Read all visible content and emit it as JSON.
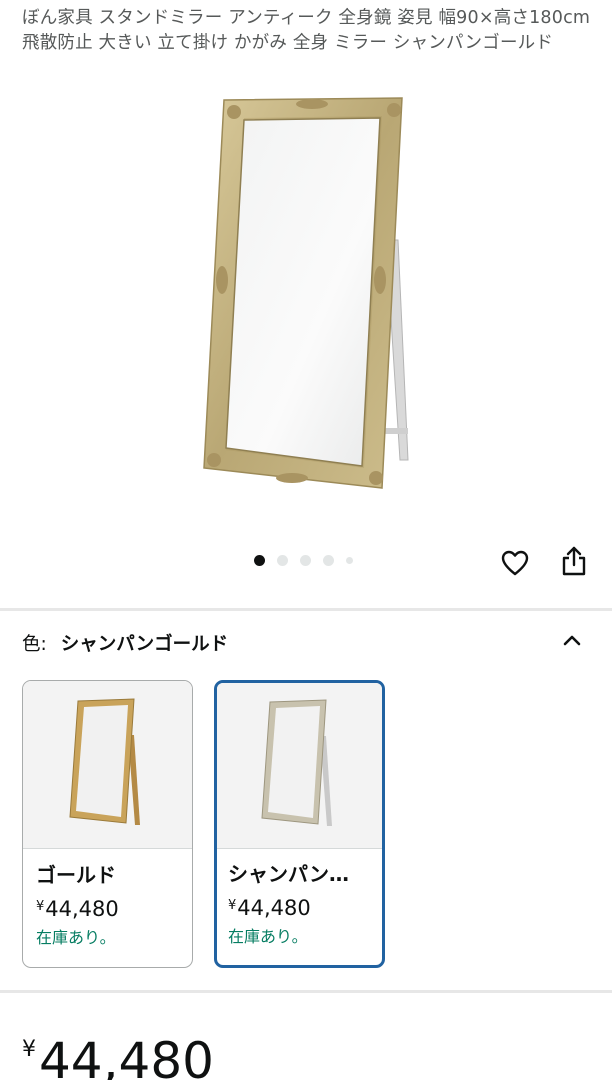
{
  "product": {
    "title": "ぼん家具 スタンドミラー アンティーク 全身鏡 姿見 幅90×高さ180cm 飛散防止 大きい 立て掛け かがみ 全身 ミラー シャンパンゴールド",
    "image_count": 5,
    "active_image_index": 0
  },
  "actions": {
    "wishlist_icon": "heart-icon",
    "share_icon": "share-icon"
  },
  "variation": {
    "label": "色:",
    "selected_value": "シャンパンゴールド",
    "toggle_icon": "chevron-up-icon",
    "options": [
      {
        "name": "ゴールド",
        "currency": "¥",
        "price": "44,480",
        "stock": "在庫あり。",
        "selected": false
      },
      {
        "name": "シャンパン…",
        "currency": "¥",
        "price": "44,480",
        "stock": "在庫あり。",
        "selected": true
      }
    ]
  },
  "price": {
    "currency": "¥",
    "amount": "44,480"
  },
  "colors": {
    "selected_border": "#2162a1",
    "in_stock": "#067d62",
    "frame_gold": "#c9b27a",
    "frame_champagne": "#c8c2ae"
  }
}
